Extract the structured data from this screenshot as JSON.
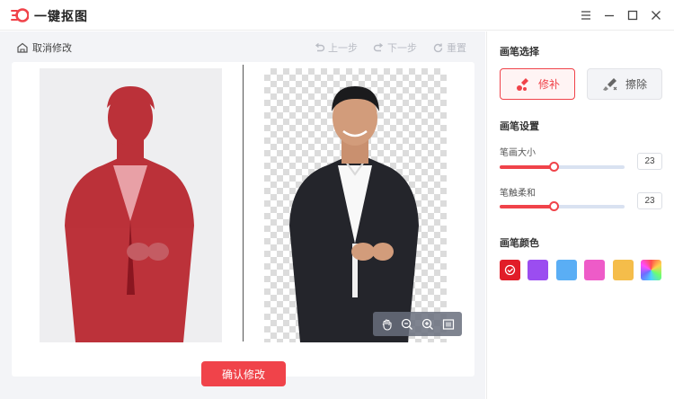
{
  "app": {
    "title": "一键抠图"
  },
  "window_controls": [
    "menu-icon",
    "minimize-icon",
    "maximize-icon",
    "close-icon"
  ],
  "toolbar": {
    "cancel_label": "取消修改",
    "undo_label": "上一步",
    "redo_label": "下一步",
    "reset_label": "重置"
  },
  "canvas": {
    "view_tools": [
      "hand-icon",
      "zoom-out-icon",
      "zoom-in-icon",
      "fit-icon"
    ]
  },
  "confirm_label": "确认修改",
  "sidebar": {
    "brush_section": "画笔选择",
    "repair_label": "修补",
    "erase_label": "擦除",
    "selected_brush": "修补",
    "settings_section": "画笔设置",
    "size_label": "笔画大小",
    "size_value": "23",
    "soft_label": "笔触柔和",
    "soft_value": "23",
    "color_section": "画笔颜色",
    "colors": [
      "#e11d28",
      "#9b4df0",
      "#5aaef5",
      "#ee5bc8",
      "#f5bd4a",
      "rainbow"
    ],
    "selected_color": "#e11d28"
  },
  "accent_color": "#f0434a"
}
